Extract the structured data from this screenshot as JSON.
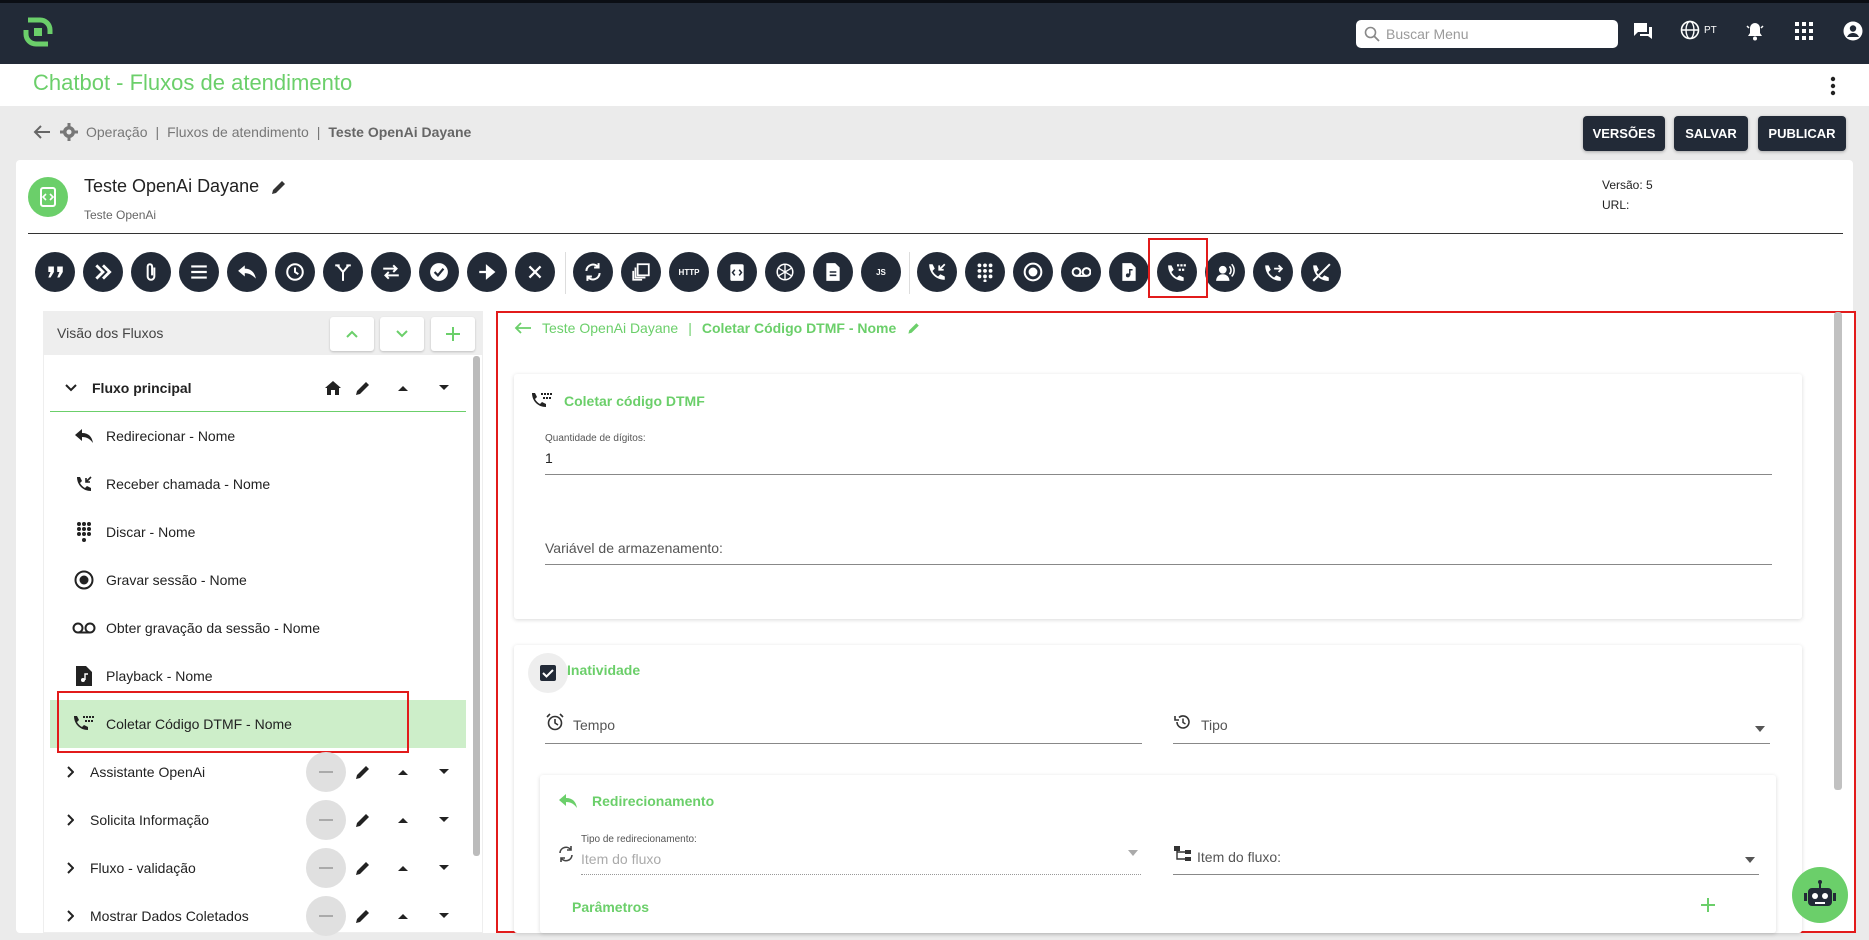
{
  "topbar": {
    "search_placeholder": "Buscar Menu",
    "lang_label": "PT",
    "icons": [
      "chat-icon",
      "globe-icon",
      "bell-icon",
      "apps-grid-icon",
      "account-icon"
    ]
  },
  "page": {
    "title": "Chatbot - Fluxos de atendimento"
  },
  "breadcrumb": {
    "items": [
      "Operação",
      "Fluxos de atendimento"
    ],
    "current": "Teste OpenAi Dayane",
    "separator": "|"
  },
  "actions": {
    "versions": "VERSÕES",
    "save": "SALVAR",
    "publish": "PUBLICAR"
  },
  "flow": {
    "name": "Teste OpenAi Dayane",
    "subtitle": "Teste OpenAi",
    "version_label": "Versão: 5",
    "url_label": "URL:"
  },
  "toolbar": {
    "tools": [
      "quote",
      "double-chevron",
      "attachment",
      "menu",
      "reply",
      "clock",
      "fork",
      "swap",
      "check",
      "arrow-right",
      "close",
      "sync",
      "copy",
      "http",
      "code",
      "openai",
      "document",
      "js",
      "incoming-call",
      "dialpad",
      "record",
      "voicemail",
      "audio-file",
      "dtmf",
      "attendant",
      "forward-call",
      "hangup"
    ],
    "http_label": "HTTP",
    "js_label": "JS"
  },
  "tree": {
    "header": "Visão dos Fluxos",
    "main_flow": "Fluxo principal",
    "items": [
      {
        "label": "Redirecionar - Nome",
        "icon": "reply-icon"
      },
      {
        "label": "Receber chamada - Nome",
        "icon": "incoming-call-icon"
      },
      {
        "label": "Discar - Nome",
        "icon": "dialpad-icon"
      },
      {
        "label": "Gravar sessão - Nome",
        "icon": "record-icon"
      },
      {
        "label": "Obter gravação da sessão - Nome",
        "icon": "voicemail-icon"
      },
      {
        "label": "Playback - Nome",
        "icon": "audio-file-icon"
      },
      {
        "label": "Coletar Código DTMF - Nome",
        "icon": "dtmf-icon",
        "selected": true
      }
    ],
    "subflows": [
      "Assistante OpenAi",
      "Solicita Informação",
      "Fluxo - validação",
      "Mostrar Dados Coletados"
    ]
  },
  "editor": {
    "breadcrumb_flow": "Teste OpenAi Dayane",
    "breadcrumb_node": "Coletar Código DTMF - Nome",
    "dtmf": {
      "title": "Coletar código DTMF",
      "digits_label": "Quantidade de dígitos:",
      "digits_value": "1",
      "storage_label": "Variável de armazenamento:"
    },
    "inactivity": {
      "label": "Inatividade",
      "checked": true,
      "time_label": "Tempo",
      "type_label": "Tipo"
    },
    "redirect": {
      "title": "Redirecionamento",
      "type_label": "Tipo de redirecionamento:",
      "type_placeholder": "Item do fluxo",
      "item_label": "Item do fluxo:"
    },
    "params_label": "Parâmetros"
  },
  "colors": {
    "accent": "#6bcf6a",
    "dark": "#222a37",
    "highlight": "#e21b1b"
  }
}
